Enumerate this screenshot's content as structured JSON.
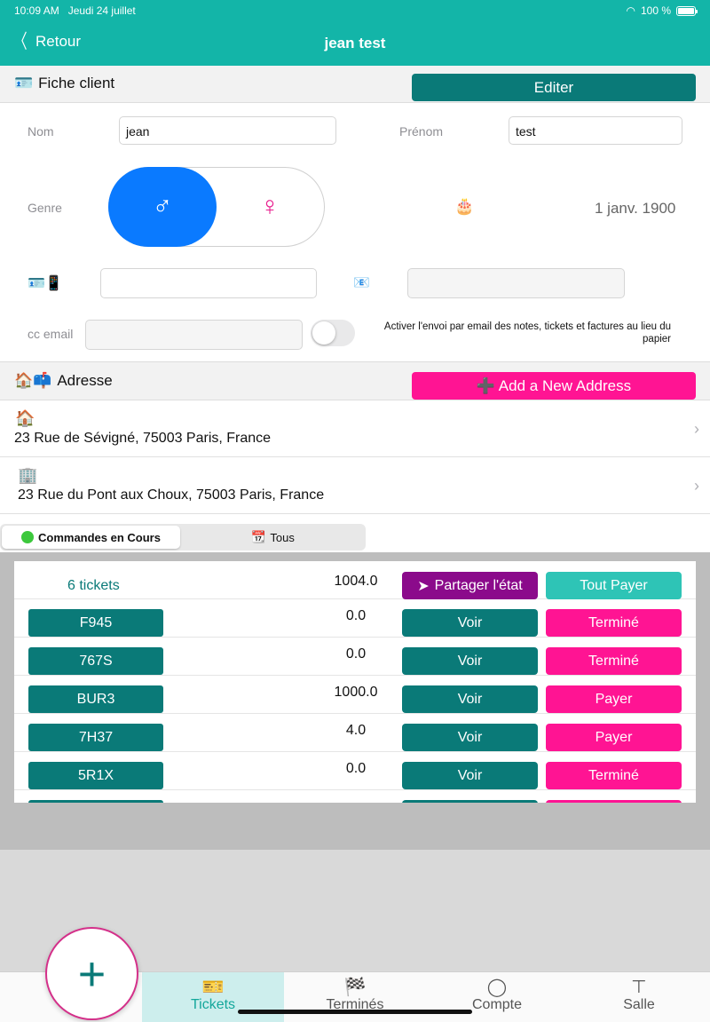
{
  "status": {
    "time": "10:09 AM",
    "date": "Jeudi 24 juillet",
    "battery": "100 %"
  },
  "nav": {
    "back_label": "Retour",
    "title": "jean test"
  },
  "client": {
    "section_icon": "id-card-icon",
    "section_title": "Fiche client",
    "edit_label": "Editer",
    "nom_label": "Nom",
    "nom_value": "jean",
    "prenom_label": "Prénom",
    "prenom_value": "test",
    "genre_label": "Genre",
    "male_symbol": "♂",
    "female_symbol": "♀",
    "birthday_icon": "🎂",
    "birthday_value": "1 janv. 1900",
    "phone_icon": "🪪📱",
    "email_icon": "📧",
    "cc_email_label": "cc email",
    "email_toggle_text": "Activer l'envoi par email des notes, tickets et factures au lieu du papier"
  },
  "address": {
    "section_icon": "🏠📫",
    "section_title": "Adresse",
    "add_label": "➕ Add a New Address",
    "items": [
      {
        "icon": "🏠",
        "text": "23 Rue de Sévigné, 75003 Paris, France"
      },
      {
        "icon": "🏢",
        "text": "23 Rue du Pont aux Choux, 75003 Paris, France"
      }
    ]
  },
  "orders": {
    "tab_active": "Commandes en Cours",
    "tab_inactive_icon": "📆",
    "tab_inactive": "Tous",
    "summary_count": "6 tickets",
    "summary_total": "1004.0",
    "share_label": "Partager l'état",
    "pay_all_label": "Tout Payer",
    "voir_label": "Voir",
    "rows": [
      {
        "code": "F945",
        "amount": "0.0",
        "status": "Terminé"
      },
      {
        "code": "767S",
        "amount": "0.0",
        "status": "Terminé"
      },
      {
        "code": "BUR3",
        "amount": "1000.0",
        "status": "Payer"
      },
      {
        "code": "7H37",
        "amount": "4.0",
        "status": "Payer"
      },
      {
        "code": "5R1X",
        "amount": "0.0",
        "status": "Terminé"
      }
    ]
  },
  "tabbar": {
    "tickets": "Tickets",
    "termines": "Terminés",
    "compte": "Compte",
    "salle": "Salle"
  },
  "colors": {
    "teal": "#13b5a8",
    "dark_teal": "#0a7a78",
    "pink": "#ff1493",
    "purple": "#8b0a8b"
  }
}
